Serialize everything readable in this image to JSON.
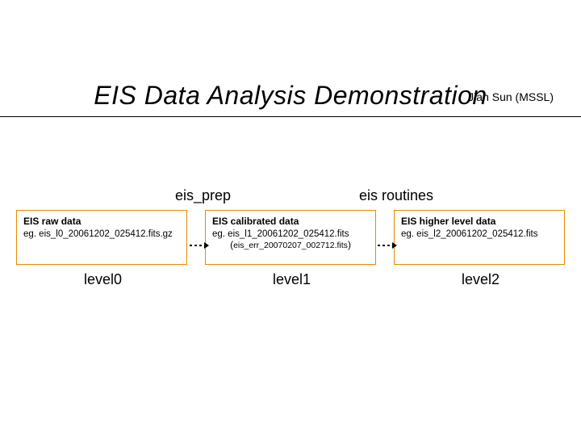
{
  "title": "EIS Data Analysis Demonstration",
  "author": "Jian Sun (MSSL)",
  "labels": {
    "prep": "eis_prep",
    "routines": "eis routines"
  },
  "boxes": {
    "b0": {
      "heading": "EIS raw data",
      "example": "eg. eis_l0_20061202_025412.fits.gz",
      "level": "level0"
    },
    "b1": {
      "heading": "EIS calibrated data",
      "example": "eg. eis_l1_20061202_025412.fits",
      "extra_open": "(",
      "extra_file": "eis_err_20070207_002712.fits",
      "extra_close": ")",
      "level": "level1"
    },
    "b2": {
      "heading": "EIS higher level data",
      "example": "eg. eis_l2_20061202_025412.fits",
      "level": "level2"
    }
  }
}
